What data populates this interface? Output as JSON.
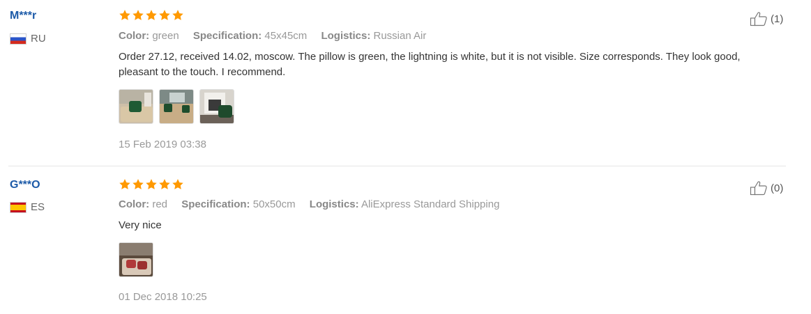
{
  "reviews": [
    {
      "user": "M***r",
      "country": "RU",
      "flag_icon": "russia-flag-icon",
      "rating": 5,
      "color_label": "Color:",
      "color": "green",
      "spec_label": "Specification:",
      "spec": "45x45cm",
      "logistics_label": "Logistics:",
      "logistics": "Russian Air",
      "content": "Order 27.12, received 14.02, moscow. The pillow is green, the lightning is white, but it is not visible. Size corresponds. They look good, pleasant to the touch. I recommend.",
      "photos": [
        "green pillow on beige sofa",
        "green pillows on sofa",
        "green pillow near fireplace"
      ],
      "date": "15 Feb 2019 03:38",
      "helpful_icon": "thumbs-up-icon",
      "helpful_count": "(1)"
    },
    {
      "user": "G***O",
      "country": "ES",
      "flag_icon": "spain-flag-icon",
      "rating": 5,
      "color_label": "Color:",
      "color": "red",
      "spec_label": "Specification:",
      "spec": "50x50cm",
      "logistics_label": "Logistics:",
      "logistics": "AliExpress Standard Shipping",
      "content": "Very nice",
      "photos": [
        "pillows on bed"
      ],
      "date": "01 Dec 2018 10:25",
      "helpful_icon": "thumbs-up-icon",
      "helpful_count": "(0)"
    }
  ],
  "colors": {
    "username": "#1c5aa8",
    "star": "#ff9900",
    "meta": "#999999"
  }
}
